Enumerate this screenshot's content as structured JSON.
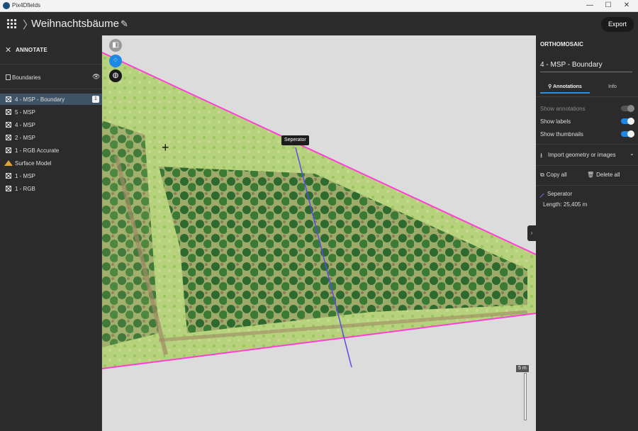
{
  "window": {
    "app_title": "Pix4Dfields",
    "min": "—",
    "max": "☐",
    "close": "✕"
  },
  "header": {
    "project_title": "Weihnachtsbäume",
    "export_label": "Export"
  },
  "sidebar": {
    "mode_label": "ANNOTATE",
    "boundaries_label": "Boundaries",
    "layers": [
      {
        "label": "4 - MSP - Boundary",
        "selected": true,
        "badge": "1"
      },
      {
        "label": "5 - MSP"
      },
      {
        "label": "4 - MSP"
      },
      {
        "label": "2 - MSP"
      },
      {
        "label": "1 - RGB Accurate"
      },
      {
        "label": "Surface Model",
        "icon": "surface-model-icon"
      },
      {
        "label": "1 - MSP"
      },
      {
        "label": "1 - RGB"
      }
    ]
  },
  "map": {
    "tooltip": "Seperator",
    "scale_label": "5 m",
    "colors": {
      "boundary": "#ff3fd6",
      "separator": "#5a4be8",
      "field": "#b9cf7a",
      "trees": "#2e6a2f"
    }
  },
  "right_panel": {
    "section_title": "ORTHOMOSAIC",
    "layer_name": "4 - MSP - Boundary",
    "tabs": {
      "annotations": "Annotations",
      "info": "Info"
    },
    "show_annotations": "Show annotations",
    "show_labels": "Show labels",
    "show_thumbnails": "Show thumbnails",
    "import_label": "Import geometry or images",
    "copy_all": "Copy all",
    "delete_all": "Delete all",
    "annotation": {
      "name": "Seperator",
      "length": "Length: 25,405 m"
    }
  }
}
